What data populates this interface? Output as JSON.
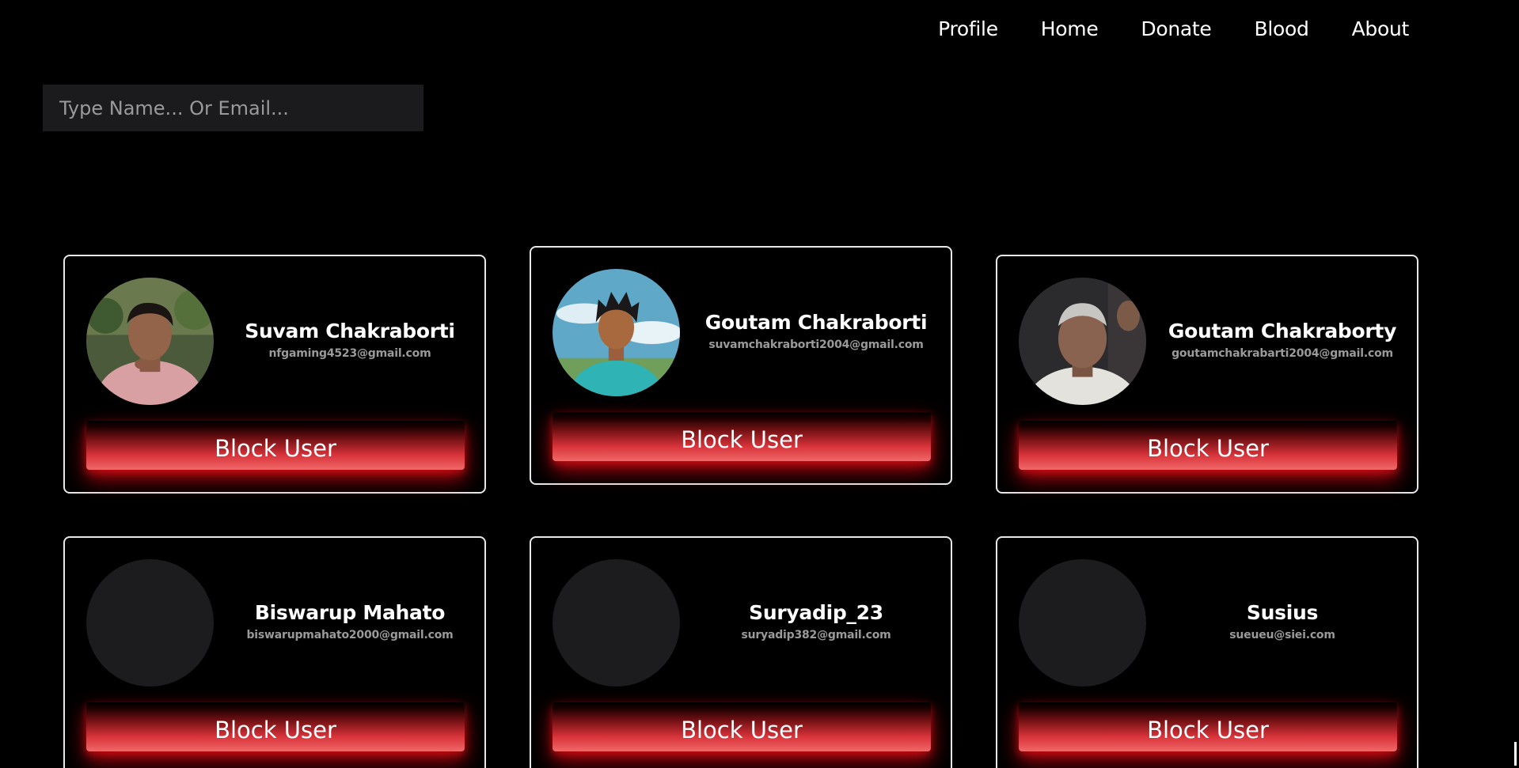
{
  "nav": {
    "items": [
      {
        "label": "Profile"
      },
      {
        "label": "Home"
      },
      {
        "label": "Donate"
      },
      {
        "label": "Blood"
      },
      {
        "label": "About"
      }
    ]
  },
  "search": {
    "placeholder": "Type Name... Or Email...",
    "value": ""
  },
  "users": [
    {
      "name": "Suvam Chakraborti",
      "email": "nfgaming4523@gmail.com",
      "avatar": "photo",
      "button": "Block User"
    },
    {
      "name": "Goutam Chakraborti",
      "email": "suvamchakraborti2004@gmail.com",
      "avatar": "illustration",
      "button": "Block User"
    },
    {
      "name": "Goutam Chakraborty",
      "email": "goutamchakrabarti2004@gmail.com",
      "avatar": "photo",
      "button": "Block User"
    },
    {
      "name": "Biswarup Mahato",
      "email": "biswarupmahato2000@gmail.com",
      "avatar": "empty",
      "button": "Block User"
    },
    {
      "name": "Suryadip_23",
      "email": "suryadip382@gmail.com",
      "avatar": "empty",
      "button": "Block User"
    },
    {
      "name": "Susius",
      "email": "sueueu@siei.com",
      "avatar": "empty",
      "button": "Block User"
    }
  ],
  "colors": {
    "background": "#000000",
    "search_bg": "#1b1b1d",
    "card_border": "#e8e8e8",
    "button_red": "#d8333a",
    "email_gray": "#9a9a9a"
  }
}
